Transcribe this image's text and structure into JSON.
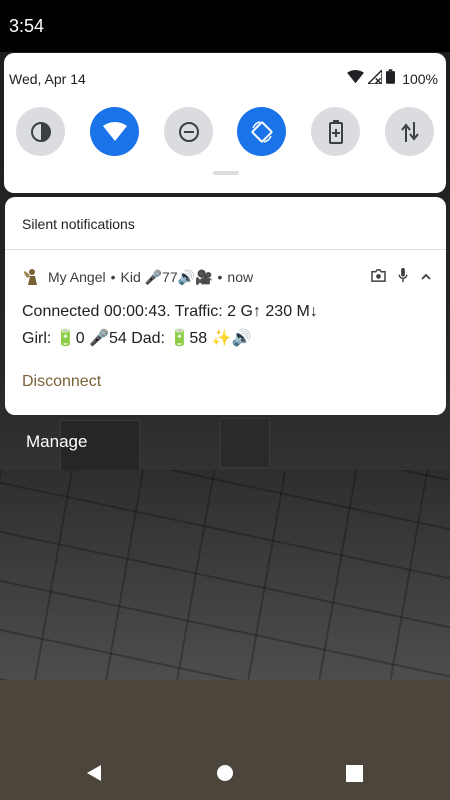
{
  "status_bar": {
    "time": "3:54"
  },
  "quick_settings": {
    "date": "Wed, Apr 14",
    "battery_percent": "100%",
    "tiles": [
      {
        "name": "invert-colors",
        "active": false
      },
      {
        "name": "wifi",
        "active": true
      },
      {
        "name": "do-not-disturb",
        "active": false
      },
      {
        "name": "auto-rotate",
        "active": true
      },
      {
        "name": "battery-saver",
        "active": false
      },
      {
        "name": "mobile-data",
        "active": false
      }
    ]
  },
  "notification": {
    "section_header": "Silent notifications",
    "app_name": "My Angel",
    "sep1": "•",
    "sub_text": "Kid 🎤77🔊🎥",
    "sep2": "•",
    "time": "now",
    "line1": "Connected 00:00:43. Traffic: 2 G↑ 230 M↓",
    "line2": "Girl: 🔋0 🎤54 Dad: 🔋58 ✨🔊",
    "action": "Disconnect"
  },
  "manage_label": "Manage",
  "colors": {
    "accent_blue": "#1a73e8",
    "tile_grey": "#dadce0",
    "action_brown": "#7a6237"
  }
}
